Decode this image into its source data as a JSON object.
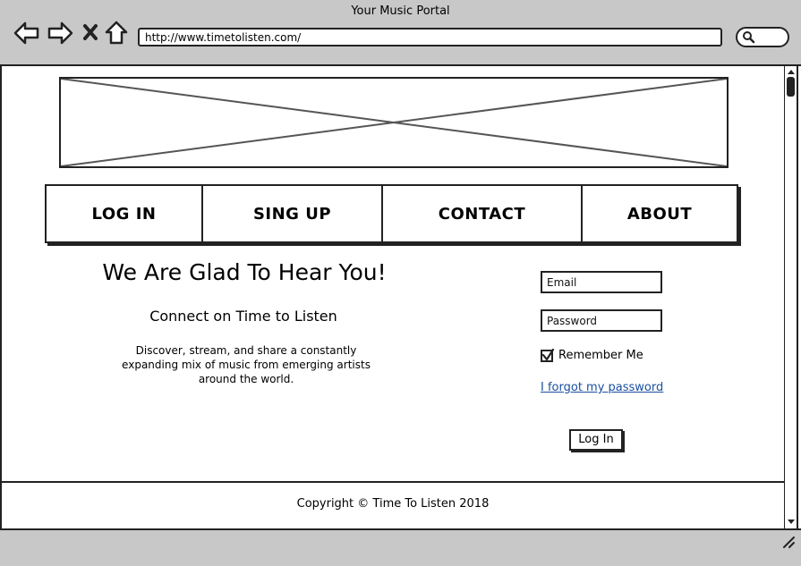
{
  "window": {
    "title": "Your Music Portal"
  },
  "browser": {
    "url": "http://www.timetolisten.com/"
  },
  "menu": {
    "items": [
      {
        "label": "LOG IN"
      },
      {
        "label": "SING UP"
      },
      {
        "label": "CONTACT"
      },
      {
        "label": "ABOUT"
      }
    ]
  },
  "hero": {
    "headline": "We Are Glad To Hear You!",
    "subhead": "Connect on Time to Listen",
    "blurb": "Discover, stream, and share a constantly expanding mix of music from emerging artists around the world."
  },
  "login": {
    "email_placeholder": "Email",
    "password_placeholder": "Password",
    "remember_label": "Remember Me",
    "remember_checked": true,
    "forgot_label": "I forgot my password",
    "submit_label": "Log In"
  },
  "footer": {
    "copyright": "Copyright © Time To Listen 2018"
  },
  "colors": {
    "chrome": "#c8c8c8",
    "link": "#1a4fa0",
    "ink": "#222222"
  }
}
